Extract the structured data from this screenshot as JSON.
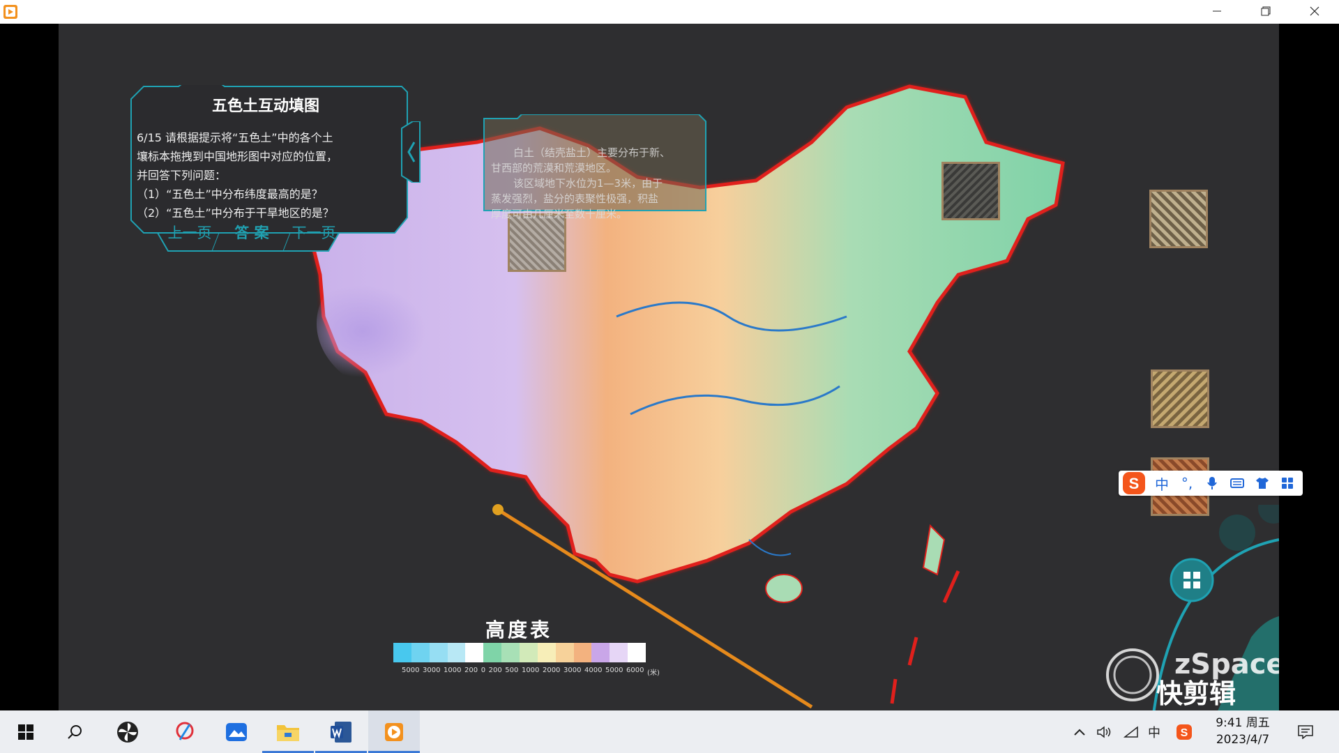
{
  "window": {
    "minimize_icon": "minimize-icon",
    "restore_icon": "restore-icon",
    "close_icon": "close-icon"
  },
  "question_panel": {
    "title": "五色土互动填图",
    "lines": [
      "6/15 请根据提示将“五色土”中的各个土",
      "壤标本拖拽到中国地形图中对应的位置，",
      "并回答下列问题：",
      "（1）“五色土”中分布纬度最高的是？",
      "（2）“五色土”中分布于干旱地区的是？"
    ],
    "prev_label": "上一页",
    "answer_label": "答 案",
    "next_label": "下一页"
  },
  "info_popup": {
    "lines": [
      "白土（结壳盐土）主要分布于新、",
      "甘西部的荒漠和荒漠地区。",
      "该区域地下水位为1—3米，由于",
      "蒸发强烈，盐分的表聚性极强，积盐",
      "厚度可由几厘米至数十厘米。"
    ]
  },
  "legend": {
    "title": "高度表",
    "labels": [
      "5000",
      "3000",
      "1000",
      "200",
      "0",
      "200",
      "500",
      "1000",
      "2000",
      "3000",
      "4000",
      "5000",
      "6000",
      "(米)"
    ],
    "colors": [
      "#48c8ee",
      "#6fd3f0",
      "#96def3",
      "#b8e8f5",
      "#ffffff",
      "#7fd4a8",
      "#a8e0b6",
      "#d2eab9",
      "#f7eeb8",
      "#f7d29a",
      "#f3b27f",
      "#c9a6e8",
      "#e6d6f6",
      "#ffffff"
    ]
  },
  "ime": {
    "logo": "S",
    "mode": "中",
    "punct": "°,"
  },
  "watermark": {
    "brand": "zSpace",
    "editor": "快剪辑"
  },
  "taskbar": {
    "clock_time": "9:41 周五",
    "clock_date": "2023/4/7",
    "ime_indicator": "中"
  },
  "colors": {
    "panel_border": "#1fa2b3",
    "map_outline": "#e0201c",
    "accent": "#f08a1c"
  }
}
